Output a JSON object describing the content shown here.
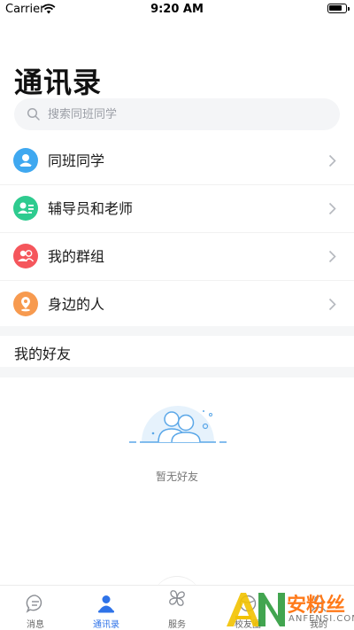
{
  "status_bar": {
    "carrier": "Carrier",
    "time": "9:20 AM"
  },
  "page": {
    "title": "通讯录"
  },
  "search": {
    "placeholder": "搜索同班同学"
  },
  "menu": {
    "items": [
      {
        "label": "同班同学",
        "icon": "classmate-icon",
        "color": "#3fa8f0"
      },
      {
        "label": "辅导员和老师",
        "icon": "teacher-icon",
        "color": "#2ecb8f"
      },
      {
        "label": "我的群组",
        "icon": "group-icon",
        "color": "#f5565c"
      },
      {
        "label": "身边的人",
        "icon": "nearby-icon",
        "color": "#f79a4f"
      }
    ]
  },
  "friends": {
    "section_title": "我的好友",
    "empty_text": "暂无好友"
  },
  "tabs": [
    {
      "label": "消息",
      "icon": "message-icon",
      "active": false
    },
    {
      "label": "通讯录",
      "icon": "contacts-icon",
      "active": true
    },
    {
      "label": "服务",
      "icon": "services-icon",
      "active": false
    },
    {
      "label": "校友圈",
      "icon": "alumni-icon",
      "active": false
    },
    {
      "label": "我的",
      "icon": "profile-icon",
      "active": false
    }
  ],
  "watermark": {
    "letters": "AN",
    "cn": "安粉丝",
    "en": "ANFENSI.COM"
  },
  "colors": {
    "accent": "#2f73e8"
  }
}
